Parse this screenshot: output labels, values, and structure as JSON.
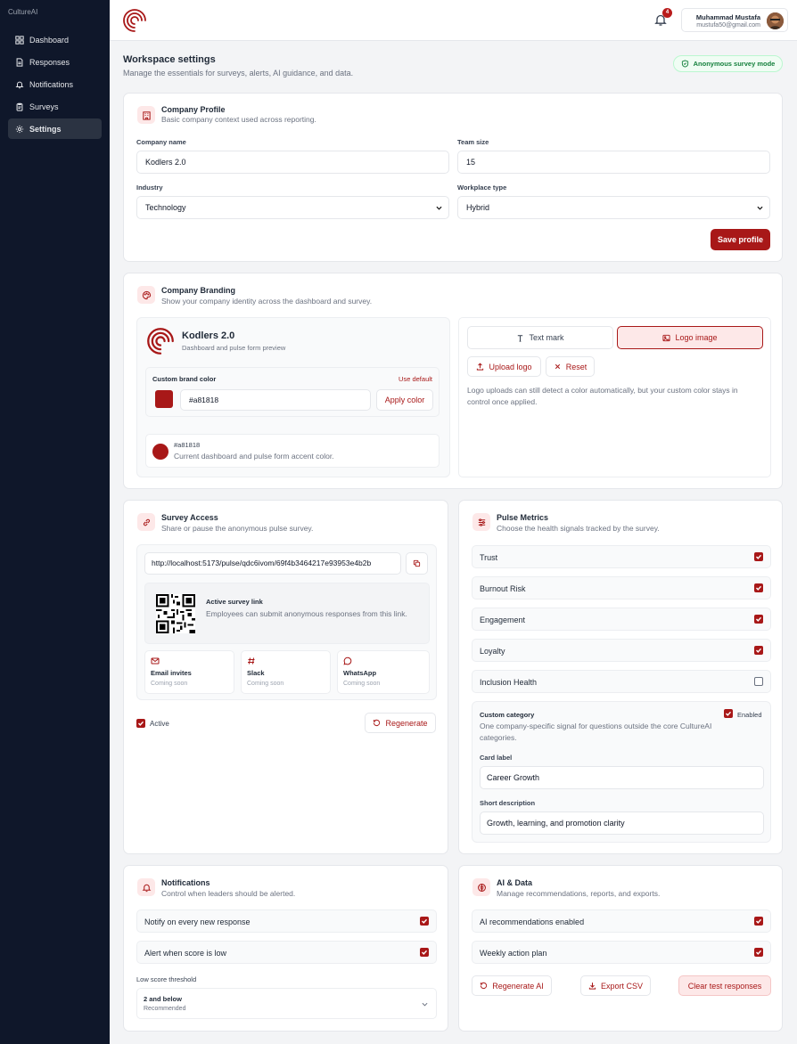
{
  "sidebar": {
    "brand": "CultureAI",
    "items": [
      {
        "label": "Dashboard",
        "icon": "grid-icon"
      },
      {
        "label": "Responses",
        "icon": "document-icon"
      },
      {
        "label": "Notifications",
        "icon": "bell-icon"
      },
      {
        "label": "Surveys",
        "icon": "clipboard-icon"
      },
      {
        "label": "Settings",
        "icon": "gear-icon",
        "active": true
      }
    ]
  },
  "header": {
    "notification_count": "4",
    "user_name": "Muhammad Mustafa",
    "user_email": "mustufa50@gmail.com"
  },
  "page": {
    "title": "Workspace settings",
    "subtitle": "Manage the essentials for surveys, alerts, AI guidance, and data.",
    "badge": "Anonymous survey mode"
  },
  "profile": {
    "title": "Company Profile",
    "subtitle": "Basic company context used across reporting.",
    "company_name_label": "Company name",
    "company_name": "Kodlers 2.0",
    "team_size_label": "Team size",
    "team_size": "15",
    "industry_label": "Industry",
    "industry": "Technology",
    "workplace_label": "Workplace type",
    "workplace": "Hybrid",
    "save_label": "Save profile"
  },
  "branding": {
    "title": "Company Branding",
    "subtitle": "Show your company identity across the dashboard and survey.",
    "preview_name": "Kodlers 2.0",
    "preview_sub": "Dashboard and pulse form preview",
    "color_label": "Custom brand color",
    "use_default": "Use default",
    "color_value": "#a81818",
    "apply_label": "Apply color",
    "accent_hex": "#a81818",
    "accent_desc": "Current dashboard and pulse form accent color.",
    "text_mark": "Text mark",
    "logo_image": "Logo image",
    "upload_logo": "Upload logo",
    "reset": "Reset",
    "note": "Logo uploads can still detect a color automatically, but your custom color stays in control once applied.",
    "brand_color": "#a81818"
  },
  "access": {
    "title": "Survey Access",
    "subtitle": "Share or pause the anonymous pulse survey.",
    "link": "http://localhost:5173/pulse/qdc6ivom/69f4b3464217e93953e4b2b",
    "active_title": "Active survey link",
    "active_desc": "Employees can submit anonymous responses from this link.",
    "channels": [
      {
        "name": "Email invites",
        "status": "Coming soon",
        "icon": "mail-icon"
      },
      {
        "name": "Slack",
        "status": "Coming soon",
        "icon": "hash-icon"
      },
      {
        "name": "WhatsApp",
        "status": "Coming soon",
        "icon": "chat-icon"
      }
    ],
    "active_label": "Active",
    "regenerate": "Regenerate"
  },
  "metrics": {
    "title": "Pulse Metrics",
    "subtitle": "Choose the health signals tracked by the survey.",
    "items": [
      {
        "label": "Trust",
        "checked": true
      },
      {
        "label": "Burnout Risk",
        "checked": true
      },
      {
        "label": "Engagement",
        "checked": true
      },
      {
        "label": "Loyalty",
        "checked": true
      },
      {
        "label": "Inclusion Health",
        "checked": false
      }
    ],
    "custom_title": "Custom category",
    "custom_enabled": "Enabled",
    "custom_desc": "One company-specific signal for questions outside the core CultureAI categories.",
    "card_label_title": "Card label",
    "card_label": "Career Growth",
    "short_desc_title": "Short description",
    "short_desc": "Growth, learning, and promotion clarity"
  },
  "notifications": {
    "title": "Notifications",
    "subtitle": "Control when leaders should be alerted.",
    "items": [
      {
        "label": "Notify on every new response",
        "checked": true
      },
      {
        "label": "Alert when score is low",
        "checked": true
      }
    ],
    "threshold_label": "Low score threshold",
    "threshold_value": "2 and below",
    "threshold_sub": "Recommended"
  },
  "ai": {
    "title": "AI & Data",
    "subtitle": "Manage recommendations, reports, and exports.",
    "items": [
      {
        "label": "AI recommendations enabled",
        "checked": true
      },
      {
        "label": "Weekly action plan",
        "checked": true
      }
    ],
    "regenerate_ai": "Regenerate AI",
    "export_csv": "Export CSV",
    "clear": "Clear test responses"
  }
}
